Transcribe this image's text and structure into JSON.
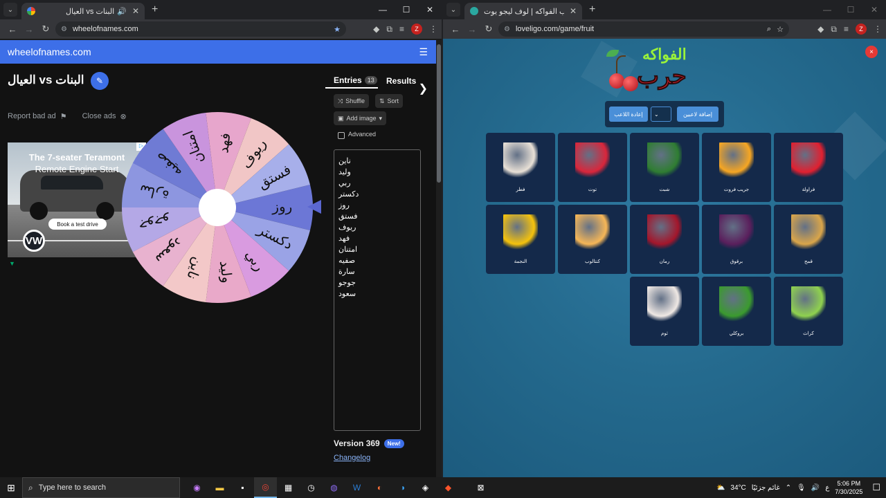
{
  "left_browser": {
    "tab_title": "العيال vs البنات",
    "url": "wheelofnames.com",
    "profile_initial": "Z"
  },
  "wheelofnames": {
    "brand": "wheelofnames.com",
    "wheel_title": "البنات vs العيال",
    "report_ad": "Report bad ad",
    "close_ads": "Close ads",
    "ad": {
      "headline": "The 7-seater Teramont",
      "subline": "Remote Engine Start",
      "cta": "Book a test drive",
      "brand_logo": "VW"
    },
    "tabs": {
      "entries": "Entries",
      "entries_count": "13",
      "results": "Results"
    },
    "buttons": {
      "shuffle": "Shuffle",
      "sort": "Sort",
      "add_image": "Add image",
      "advanced": "Advanced"
    },
    "entries": [
      "ناين",
      "وليد",
      "ربي",
      "دكستر",
      "روز",
      "فستق",
      "ريوف",
      "فهد",
      "امتنان",
      "صفيه",
      "سارة",
      "جوجو",
      "سعود"
    ],
    "wheel_segments": [
      {
        "label": "روز",
        "color": "#6c77d6"
      },
      {
        "label": "دكستر",
        "color": "#9aa3e6"
      },
      {
        "label": "ربي",
        "color": "#d99be0"
      },
      {
        "label": "وليد",
        "color": "#e9a9c9"
      },
      {
        "label": "ناين",
        "color": "#f3c8c8"
      },
      {
        "label": "سعود",
        "color": "#e8b2cf"
      },
      {
        "label": "جوجو",
        "color": "#b4a8e6"
      },
      {
        "label": "سارة",
        "color": "#8d96e0"
      },
      {
        "label": "صفيه",
        "color": "#6f7bd4"
      },
      {
        "label": "امتنان",
        "color": "#c994dd"
      },
      {
        "label": "فهد",
        "color": "#e7a6cc"
      },
      {
        "label": "ريوف",
        "color": "#f1c6c6"
      },
      {
        "label": "فستق",
        "color": "#a7afea"
      }
    ],
    "version": "Version 369",
    "new_badge": "New!",
    "changelog": "Changelog"
  },
  "right_browser": {
    "tab_title": "لعبة حرب الفواكه | لوف ليجو يوت",
    "url": "loveligo.com/game/fruit",
    "profile_initial": "Z"
  },
  "fruit_game": {
    "logo_top": "الفواكه",
    "logo_main": "حرب",
    "close": "×",
    "add_players": "إضافة لاعبين",
    "reset_players": "إعادة اللاعب",
    "select_value": "",
    "cards": [
      {
        "label": "فطر",
        "icon": "mushroom-icon",
        "color": "#e8e0d6"
      },
      {
        "label": "توت",
        "icon": "raspberry-icon",
        "color": "#d9263b"
      },
      {
        "label": "شبت",
        "icon": "dill-icon",
        "color": "#2f7d32"
      },
      {
        "label": "جريب فروت",
        "icon": "grapefruit-icon",
        "color": "#f6a623"
      },
      {
        "label": "فراولة",
        "icon": "strawberry-icon",
        "color": "#e02030"
      },
      {
        "label": "النجمة",
        "icon": "starfruit-icon",
        "color": "#f4c20d"
      },
      {
        "label": "كنتالوب",
        "icon": "cantaloupe-icon",
        "color": "#f5b657"
      },
      {
        "label": "رمان",
        "icon": "pomegranate-icon",
        "color": "#a3162b"
      },
      {
        "label": "برقوق",
        "icon": "plum-icon",
        "color": "#5a1f5c"
      },
      {
        "label": "قمح",
        "icon": "wheat-icon",
        "color": "#d9a54a"
      },
      {
        "label": "ثوم",
        "icon": "garlic-icon",
        "color": "#efe8e4"
      },
      {
        "label": "بروكلي",
        "icon": "broccoli-icon",
        "color": "#3b9a2f"
      },
      {
        "label": "كراث",
        "icon": "leek-icon",
        "color": "#8fd14f"
      }
    ]
  },
  "taskbar": {
    "search_placeholder": "Type here to search",
    "weather_temp": "34°C",
    "weather_text": "غائم جزئيًا",
    "lang": "ع",
    "time": "5:06 PM",
    "date": "7/30/2025"
  }
}
